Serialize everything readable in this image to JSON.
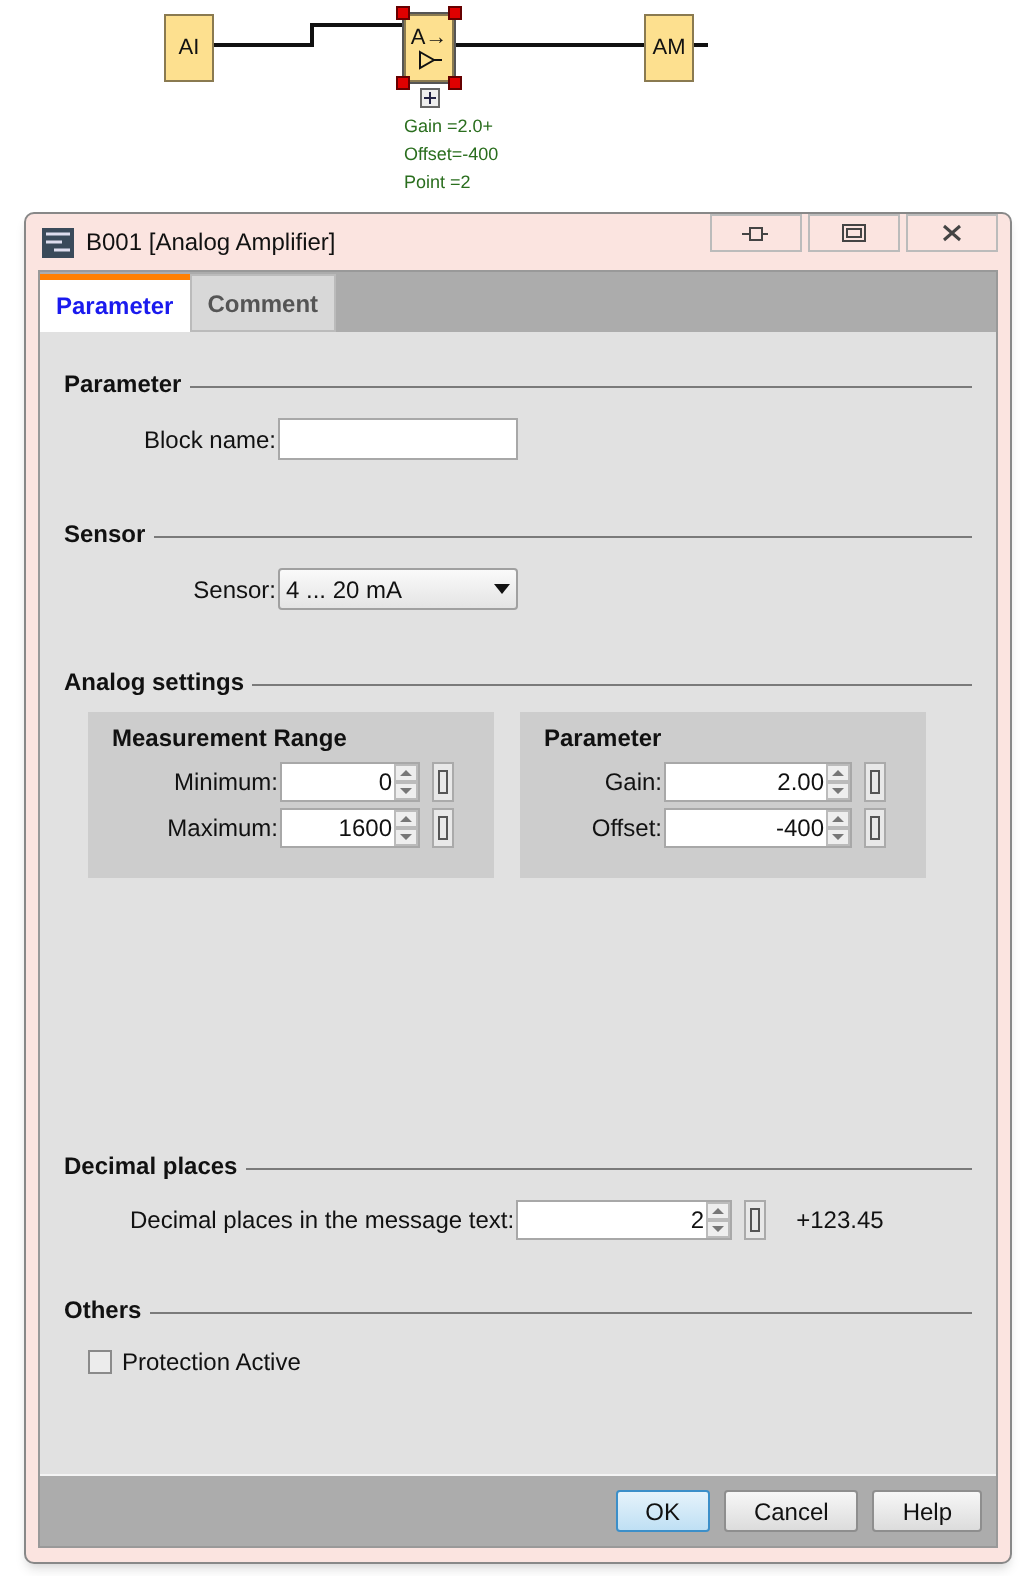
{
  "diagram": {
    "blocks": [
      {
        "kind": "input",
        "label": "AI",
        "selected": false
      },
      {
        "kind": "amplifier",
        "label": "A→",
        "selected": true
      },
      {
        "kind": "output",
        "label": "AM",
        "selected": false
      }
    ],
    "annotations": [
      "Gain =2.0+",
      "Offset=-400",
      "Point =2"
    ]
  },
  "window": {
    "title": "B001 [Analog Amplifier]"
  },
  "tabs": [
    {
      "label": "Parameter",
      "selected": true
    },
    {
      "label": "Comment",
      "selected": false
    }
  ],
  "parameter": {
    "heading": "Parameter",
    "block_name_label": "Block name:"
  },
  "sensor": {
    "heading": "Sensor",
    "label": "Sensor:",
    "value": "4 ... 20 mA"
  },
  "analog_settings": {
    "heading": "Analog settings",
    "groups": [
      {
        "title": "Measurement Range",
        "fields": [
          {
            "label": "Minimum:",
            "value": "0"
          },
          {
            "label": "Maximum:",
            "value": "1600"
          }
        ]
      },
      {
        "title": "Parameter",
        "fields": [
          {
            "label": "Gain:",
            "value": "2.00"
          },
          {
            "label": "Offset:",
            "value": "-400"
          }
        ]
      }
    ]
  },
  "decimal_places": {
    "heading": "Decimal places",
    "label": "Decimal places in the message text:",
    "value": "2",
    "preview": "+123.45"
  },
  "others": {
    "heading": "Others",
    "checkbox": {
      "label": "Protection Active",
      "checked": false
    }
  },
  "buttons": [
    {
      "label": "OK",
      "default": true
    },
    {
      "label": "Cancel",
      "default": false
    },
    {
      "label": "Help",
      "default": false
    }
  ]
}
